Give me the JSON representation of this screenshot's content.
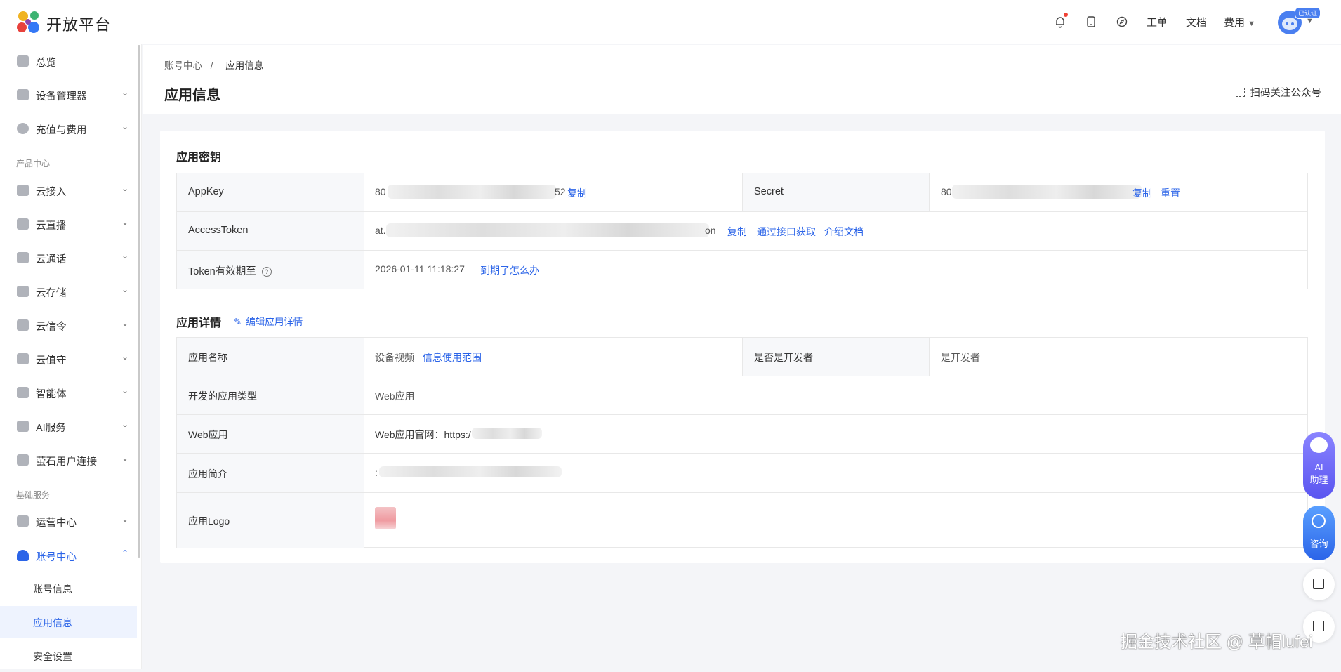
{
  "header": {
    "brand": "开放平台",
    "links": [
      "工单",
      "文档",
      "费用"
    ],
    "avatar_badge": "已认证",
    "icons": [
      "bell-icon",
      "tablet-icon",
      "compass-icon"
    ]
  },
  "sidebar": {
    "items": [
      {
        "label": "总览",
        "icon": "home-icon"
      },
      {
        "label": "设备管理器",
        "icon": "device-icon"
      },
      {
        "label": "充值与费用",
        "icon": "coin-icon"
      }
    ],
    "group_product": "产品中心",
    "product_items": [
      {
        "label": "云接入",
        "icon": "shield-icon"
      },
      {
        "label": "云直播",
        "icon": "cloud-icon"
      },
      {
        "label": "云通话",
        "icon": "phone-icon"
      },
      {
        "label": "云存储",
        "icon": "storage-icon"
      },
      {
        "label": "云信令",
        "icon": "message-icon"
      },
      {
        "label": "云值守",
        "icon": "house-icon"
      },
      {
        "label": "智能体",
        "icon": "agent-icon"
      },
      {
        "label": "AI服务",
        "icon": "ai-service-icon"
      },
      {
        "label": "萤石用户连接",
        "icon": "connect-icon"
      }
    ],
    "group_basic": "基础服务",
    "basic_items": [
      {
        "label": "运营中心",
        "icon": "chart-icon"
      },
      {
        "label": "账号中心",
        "icon": "user-icon"
      }
    ],
    "sub_items": [
      "账号信息",
      "应用信息",
      "安全设置"
    ]
  },
  "page": {
    "breadcrumb_parent": "账号中心",
    "breadcrumb_sep": "/",
    "breadcrumb_current": "应用信息",
    "title": "应用信息",
    "scan_label": "扫码关注公众号"
  },
  "keys": {
    "title": "应用密钥",
    "appkey_label": "AppKey",
    "appkey_prefix": "80",
    "appkey_suffix": "52",
    "secret_label": "Secret",
    "secret_prefix": "80",
    "copy": "复制",
    "reset": "重置",
    "token_label": "AccessToken",
    "token_prefix": "at.",
    "token_suffix": "on",
    "token_api": "通过接口获取",
    "token_doc": "介绍文档",
    "expire_label": "Token有效期至",
    "expire_value": "2026-01-11 11:18:27",
    "expire_link": "到期了怎么办"
  },
  "details": {
    "title": "应用详情",
    "edit": "编辑应用详情",
    "name_label": "应用名称",
    "name_value": "设备视频",
    "scope_link": "信息使用范围",
    "dev_label": "是否是开发者",
    "dev_value": "是开发者",
    "type_label": "开发的应用类型",
    "type_value": "Web应用",
    "web_label": "Web应用",
    "web_value": "Web应用官网：https:/",
    "intro_label": "应用简介",
    "intro_prefix": ":",
    "logo_label": "应用Logo"
  },
  "floating": {
    "ai_line1": "AI",
    "ai_line2": "助理",
    "consult": "咨询"
  },
  "watermark": "掘金技术社区 @ 草帽lufei"
}
